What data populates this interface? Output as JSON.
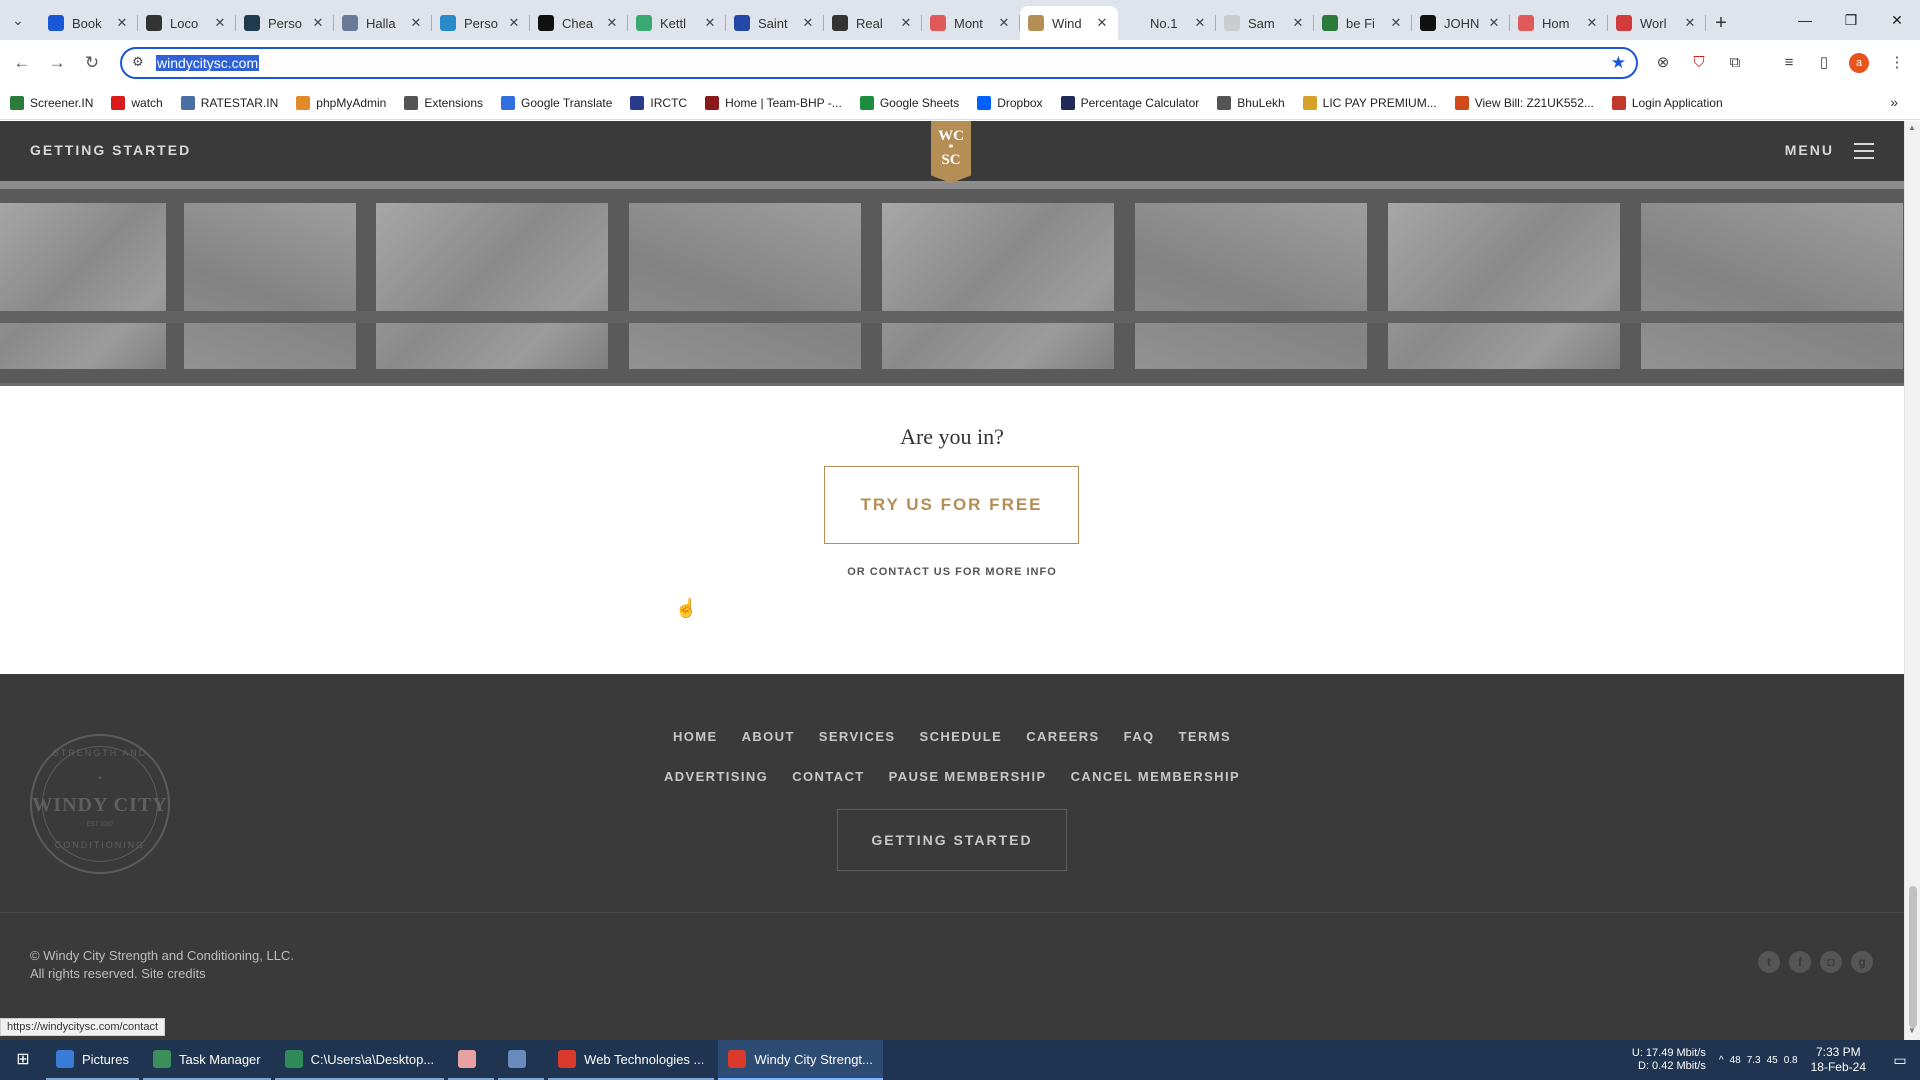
{
  "browser": {
    "tabs": [
      {
        "title": "Book",
        "color": "#1a57d6",
        "icon": "star-icon"
      },
      {
        "title": "Loco",
        "color": "#333333",
        "icon": "wave-icon"
      },
      {
        "title": "Perso",
        "color": "#1f3b4d",
        "icon": "square-icon"
      },
      {
        "title": "Halla",
        "color": "#6c7a99",
        "icon": "trend-icon"
      },
      {
        "title": "Perso",
        "color": "#2a8ac9",
        "icon": "circle-icon"
      },
      {
        "title": "Chea",
        "color": "#111111",
        "icon": "square-icon"
      },
      {
        "title": "Kettl",
        "color": "#3aa870",
        "icon": "drop-icon"
      },
      {
        "title": "Saint",
        "color": "#2448a8",
        "icon": "swirl-icon"
      },
      {
        "title": "Real",
        "color": "#333333",
        "icon": "cube-icon"
      },
      {
        "title": "Mont",
        "color": "#e05a5a",
        "icon": "flag-icon"
      },
      {
        "title": "Wind",
        "color": "#b58e56",
        "icon": "asterisk-icon",
        "active": true
      },
      {
        "title": "No.1",
        "color": "#dfe3eb",
        "icon": "blank-icon"
      },
      {
        "title": "Sam",
        "color": "#cccccc",
        "icon": "blank-icon"
      },
      {
        "title": "be Fi",
        "color": "#2b7a3a",
        "icon": "be-icon"
      },
      {
        "title": "JOHN",
        "color": "#111111",
        "icon": "jr-icon"
      },
      {
        "title": "Hom",
        "color": "#e05a5a",
        "icon": "flag-icon"
      },
      {
        "title": "Worl",
        "color": "#d13b3b",
        "icon": "up-icon"
      }
    ],
    "url": "windycitysc.com",
    "bookmarks": [
      {
        "label": "Screener.IN",
        "color": "#2b7a3a"
      },
      {
        "label": "watch",
        "color": "#d91b1b"
      },
      {
        "label": "RATESTAR.IN",
        "color": "#4a6fa5"
      },
      {
        "label": "phpMyAdmin",
        "color": "#e08a2a"
      },
      {
        "label": "Extensions",
        "color": "#555555"
      },
      {
        "label": "Google Translate",
        "color": "#2f6fe0"
      },
      {
        "label": "IRCTC",
        "color": "#2a3a8a"
      },
      {
        "label": "Home | Team-BHP -...",
        "color": "#8a1a1a"
      },
      {
        "label": "Google Sheets",
        "color": "#1e8e3e"
      },
      {
        "label": "Dropbox",
        "color": "#0061fe"
      },
      {
        "label": "Percentage Calculator",
        "color": "#1d2a5a"
      },
      {
        "label": "BhuLekh",
        "color": "#555555"
      },
      {
        "label": "LIC PAY PREMIUM...",
        "color": "#d6a12a"
      },
      {
        "label": "View Bill: Z21UK552...",
        "color": "#d1491b"
      },
      {
        "label": "Login Application",
        "color": "#c0392b"
      }
    ]
  },
  "site": {
    "header": {
      "left_label": "GETTING STARTED",
      "logo_line1": "WC",
      "logo_star": "*",
      "logo_line2": "SC",
      "menu_label": "MENU"
    },
    "cta": {
      "question": "Are you in?",
      "button": "TRY US FOR FREE",
      "contact": "OR CONTACT US FOR MORE INFO"
    },
    "footer": {
      "seal": {
        "top": "STRENGTH AND",
        "star": "*",
        "name": "WINDY CITY",
        "est": "EST 2007",
        "bottom": "CONDITIONING"
      },
      "nav_row1": [
        "HOME",
        "ABOUT",
        "SERVICES",
        "SCHEDULE",
        "CAREERS",
        "FAQ",
        "TERMS"
      ],
      "nav_row2": [
        "ADVERTISING",
        "CONTACT",
        "PAUSE MEMBERSHIP",
        "CANCEL MEMBERSHIP"
      ],
      "getting_started": "GETTING STARTED",
      "copyright_line1": "© Windy City Strength and Conditioning, LLC.",
      "copyright_line2": "All rights reserved. Site credits",
      "social": [
        "twitter-icon",
        "facebook-icon",
        "instagram-icon",
        "google-plus-icon"
      ]
    },
    "status_url": "https://windycitysc.com/contact"
  },
  "taskbar": {
    "items": [
      {
        "label": "Pictures",
        "color": "#3a7bd5"
      },
      {
        "label": "Task Manager",
        "color": "#3b8f5a"
      },
      {
        "label": "C:\\Users\\a\\Desktop...",
        "color": "#2e8b57"
      },
      {
        "label": "",
        "color": "#e9a0a0"
      },
      {
        "label": "",
        "color": "#6a8bbd"
      },
      {
        "label": "Web Technologies ...",
        "color": "#d93a2b"
      },
      {
        "label": "Windy City Strengt...",
        "color": "#d93a2b",
        "active": true
      }
    ],
    "net_up": "U:  17.49 Mbit/s",
    "net_down": "D:  0.42 Mbit/s",
    "tray_values": [
      "48",
      "7.3",
      "45",
      "0.8"
    ],
    "time": "7:33 PM",
    "date": "18-Feb-24"
  }
}
